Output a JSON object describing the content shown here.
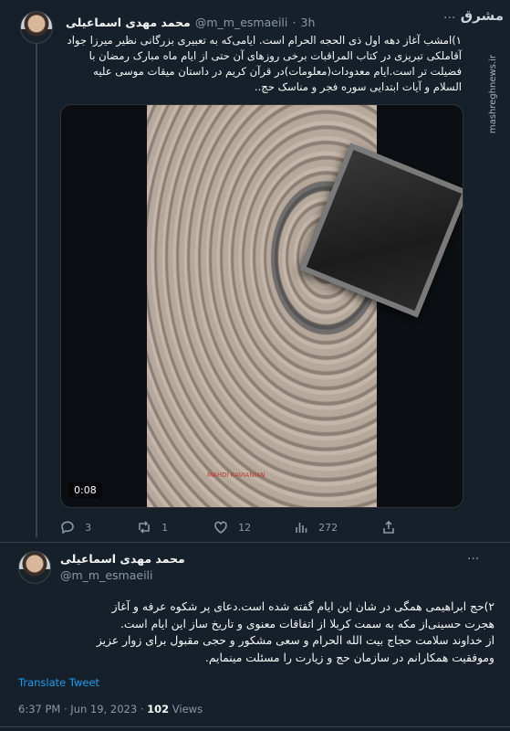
{
  "watermark": {
    "logo": "مشرق",
    "url": "mashreghnews.ir"
  },
  "tweet1": {
    "author": "محمد مهدی اسماعیلی",
    "handle": "@m_m_esmaeili",
    "sep": "·",
    "time": "3h",
    "lines": [
      "۱)امشب آغاز دهه اول ذی الحجه الحرام است. ایامی‌که به تعبیری بزرگانی نظیر میرزا جواد",
      "آقاملکی تبریزی در کتاب المراقبات برخی روزهای آن حتی از ایام ماه مبارک رمضان با",
      "فضیلت تر است.ایام معدودات(معلومات)در قرآن کریم در داستان میقات موسی علیه",
      "السلام و آیات ابتدایی سوره فجر و مناسک حج.."
    ],
    "video_time": "0:08",
    "video_caption": "MAHDI KAVIANIAN",
    "replies": "3",
    "retweets": "1",
    "likes": "12",
    "views": "272"
  },
  "tweet2": {
    "author": "محمد مهدی اسماعیلی",
    "handle": "@m_m_esmaeili",
    "lines": [
      "۲)حج ابراهیمی همگی در شان این ایام گفته شده است.دعای پر شکوه عرفه و آغاز",
      "هجرت حسینی‌از مکه به سمت کربلا از اتفاقات معنوی و تاریخ ساز این ایام است.",
      "از خداوند سلامت حجاج بیت الله الحرام و سعی مشکور و حجی مقبول برای زوار عزیز",
      "وموفقیت همکارانم در سازمان حج و زیارت را مسئلت مینمایم."
    ],
    "translate": "Translate Tweet",
    "timestamp": "6:37 PM · Jun 19, 2023 ·",
    "views_count": "102",
    "views_label": "Views"
  },
  "colors": {
    "background": "#15202b",
    "accent": "#1d9bf0",
    "muted": "#8b98a5"
  }
}
